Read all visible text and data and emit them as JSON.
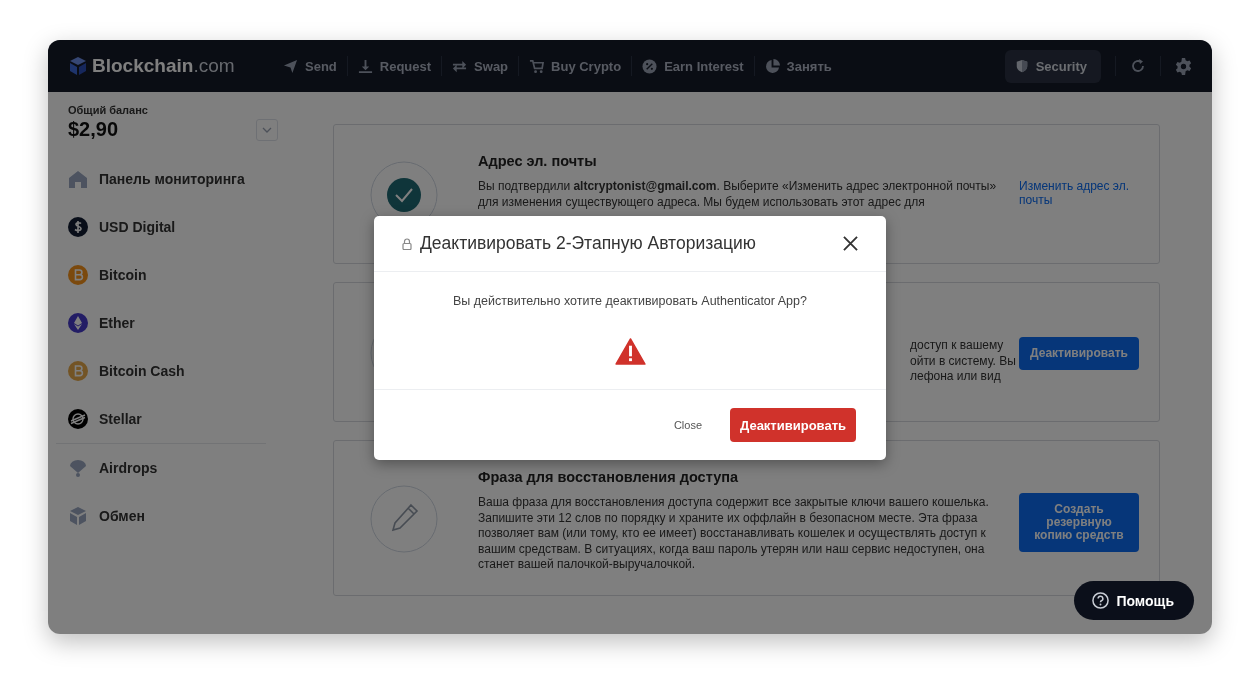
{
  "logo": {
    "name": "Blockchain",
    "suffix": ".com"
  },
  "nav": [
    {
      "label": "Send"
    },
    {
      "label": "Request"
    },
    {
      "label": "Swap"
    },
    {
      "label": "Buy Crypto"
    },
    {
      "label": "Earn Interest"
    },
    {
      "label": "Занять"
    }
  ],
  "security": {
    "label": "Security",
    "selected": true
  },
  "balance": {
    "label": "Общий баланс",
    "amount": "$2,90"
  },
  "sidebar": {
    "assets": [
      {
        "label": "Панель мониторинга"
      },
      {
        "label": "USD Digital"
      },
      {
        "label": "Bitcoin"
      },
      {
        "label": "Ether"
      },
      {
        "label": "Bitcoin Cash"
      },
      {
        "label": "Stellar"
      }
    ],
    "tools": [
      {
        "label": "Airdrops"
      },
      {
        "label": "Обмен"
      }
    ]
  },
  "cards": [
    {
      "title": "Адрес эл. почты",
      "lines": [
        "Вы подтвердили **altcryptonist@gmail.com**. Выберите «Изменить адрес электронной почты»",
        "для изменения существующего адреса. Мы будем использовать этот адрес для"
      ],
      "action": {
        "kind": "link",
        "label": "Изменить адрес эл. почты"
      }
    },
    {
      "fragments": [
        "доступ к вашему",
        "ойти в систему. Вы",
        "лефона или вид"
      ],
      "action": {
        "kind": "button",
        "label": "Деактивировать"
      }
    },
    {
      "title": "Фраза для восстановления доступа",
      "lines": [
        "Ваша фраза для восстановления доступа содержит все закрытые ключи вашего кошелька.",
        "Запишите эти 12 слов по порядку и храните их оффлайн в безопасном месте. Эта фраза",
        "позволяет вам (или тому, кто ее имеет) восстанавливать кошелек и осуществлять доступ к",
        "вашим средствам.  В ситуациях, когда ваш пароль утерян или наш сервис недоступен, она",
        "станет вашей палочкой-выручалочкой."
      ],
      "action": {
        "kind": "button",
        "label": "Создать резервную копию средств"
      }
    }
  ],
  "help": {
    "label": "Помощь"
  },
  "modal": {
    "title": "Деактивировать 2-Этапную Авторизацию",
    "message": "Вы действительно хотите деактивировать Authenticator App?",
    "close": "Close",
    "confirm": "Деактивировать"
  }
}
